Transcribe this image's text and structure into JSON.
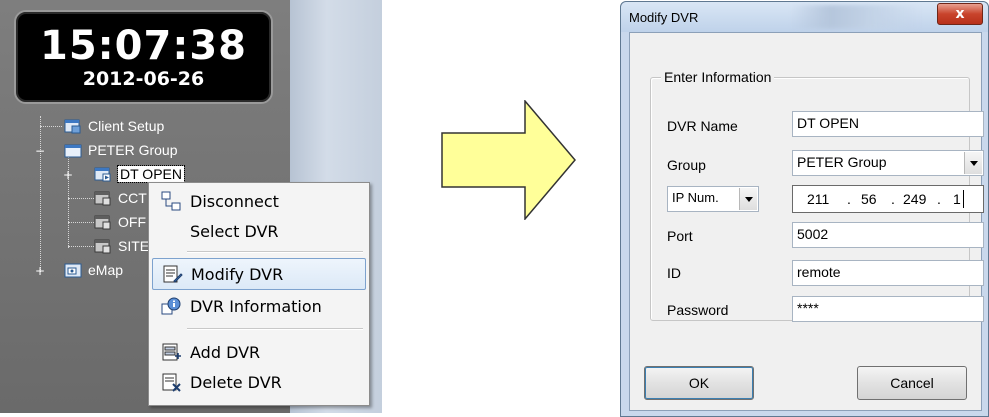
{
  "clock": {
    "time": "15:07:38",
    "date": "2012-06-26"
  },
  "tree": {
    "items": [
      {
        "label": "Client Setup",
        "icon": "client-setup-icon"
      },
      {
        "label": "PETER Group",
        "icon": "folder-icon",
        "expander": "−"
      },
      {
        "label": "DT OPEN",
        "icon": "dvr-icon",
        "expander": "+"
      },
      {
        "label": "CCT",
        "icon": "dvr-icon"
      },
      {
        "label": "OFF",
        "icon": "dvr-icon"
      },
      {
        "label": "SITE",
        "icon": "dvr-icon"
      },
      {
        "label": "eMap",
        "icon": "emap-icon",
        "expander": "+"
      }
    ]
  },
  "context_menu": {
    "items": [
      {
        "label": "Disconnect",
        "icon": "disconnect-icon"
      },
      {
        "label": "Select DVR"
      },
      {
        "label": "Modify DVR",
        "icon": "modify-dvr-icon",
        "highlighted": true
      },
      {
        "label": "DVR Information",
        "icon": "dvr-info-icon"
      },
      {
        "label": "Add DVR",
        "icon": "add-dvr-icon"
      },
      {
        "label": "Delete DVR",
        "icon": "delete-dvr-icon"
      }
    ]
  },
  "dialog": {
    "title": "Modify DVR",
    "close_label": "x",
    "group_title": "Enter Information",
    "fields": {
      "dvr_name": {
        "label": "DVR Name",
        "value": "DT OPEN"
      },
      "group": {
        "label": "Group",
        "value": "PETER Group"
      },
      "ip": {
        "type_value": "IP Num.",
        "octets": [
          "211",
          "56",
          "249",
          "1"
        ]
      },
      "port": {
        "label": "Port",
        "value": "5002"
      },
      "id": {
        "label": "ID",
        "value": "remote"
      },
      "password": {
        "label": "Password",
        "value": "****"
      }
    },
    "buttons": {
      "ok": "OK",
      "cancel": "Cancel"
    }
  },
  "colors": {
    "arrow_fill": "#ffff99",
    "highlight_border": "#7da2ce",
    "panel_grey": "#747474"
  }
}
